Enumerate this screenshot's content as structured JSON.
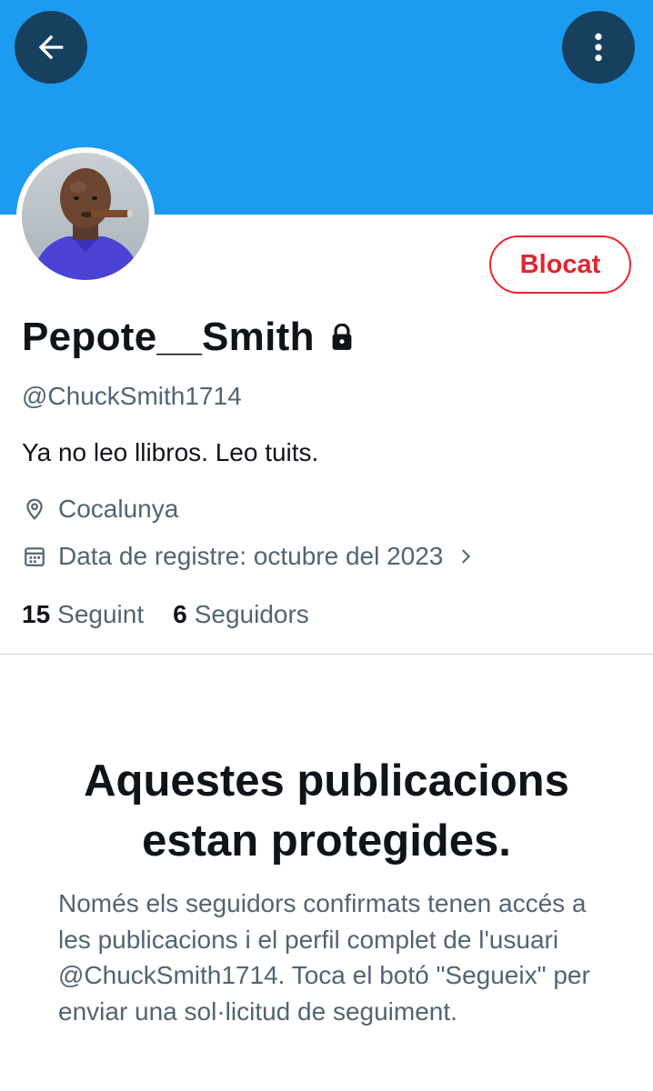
{
  "header": {
    "back_icon": "arrow-left-icon",
    "more_icon": "more-vertical-icon",
    "banner_color": "#1d9bf0"
  },
  "profile": {
    "display_name": "Pepote__Smith",
    "handle": "@ChuckSmith1714",
    "bio": "Ya no leo llibros. Leo tuits.",
    "location": "Cocalunya",
    "joined": "Data de registre: octubre del 2023",
    "blocked_button_label": "Blocat",
    "protected_icon": "lock-icon"
  },
  "stats": {
    "following_count": "15",
    "following_label": "Seguint",
    "followers_count": "6",
    "followers_label": "Seguidors"
  },
  "protected_notice": {
    "title": "Aquestes publicacions estan protegides.",
    "body": "Només els seguidors confirmats tenen accés a les publicacions i el perfil complet de l'usuari @ChuckSmith1714. Toca el botó \"Segueix\" per enviar una sol·licitud de seguiment."
  },
  "colors": {
    "accent_blue": "#1d9bf0",
    "blocked_red": "#f4212e",
    "text_primary": "#0f1419",
    "text_secondary": "#536471"
  }
}
